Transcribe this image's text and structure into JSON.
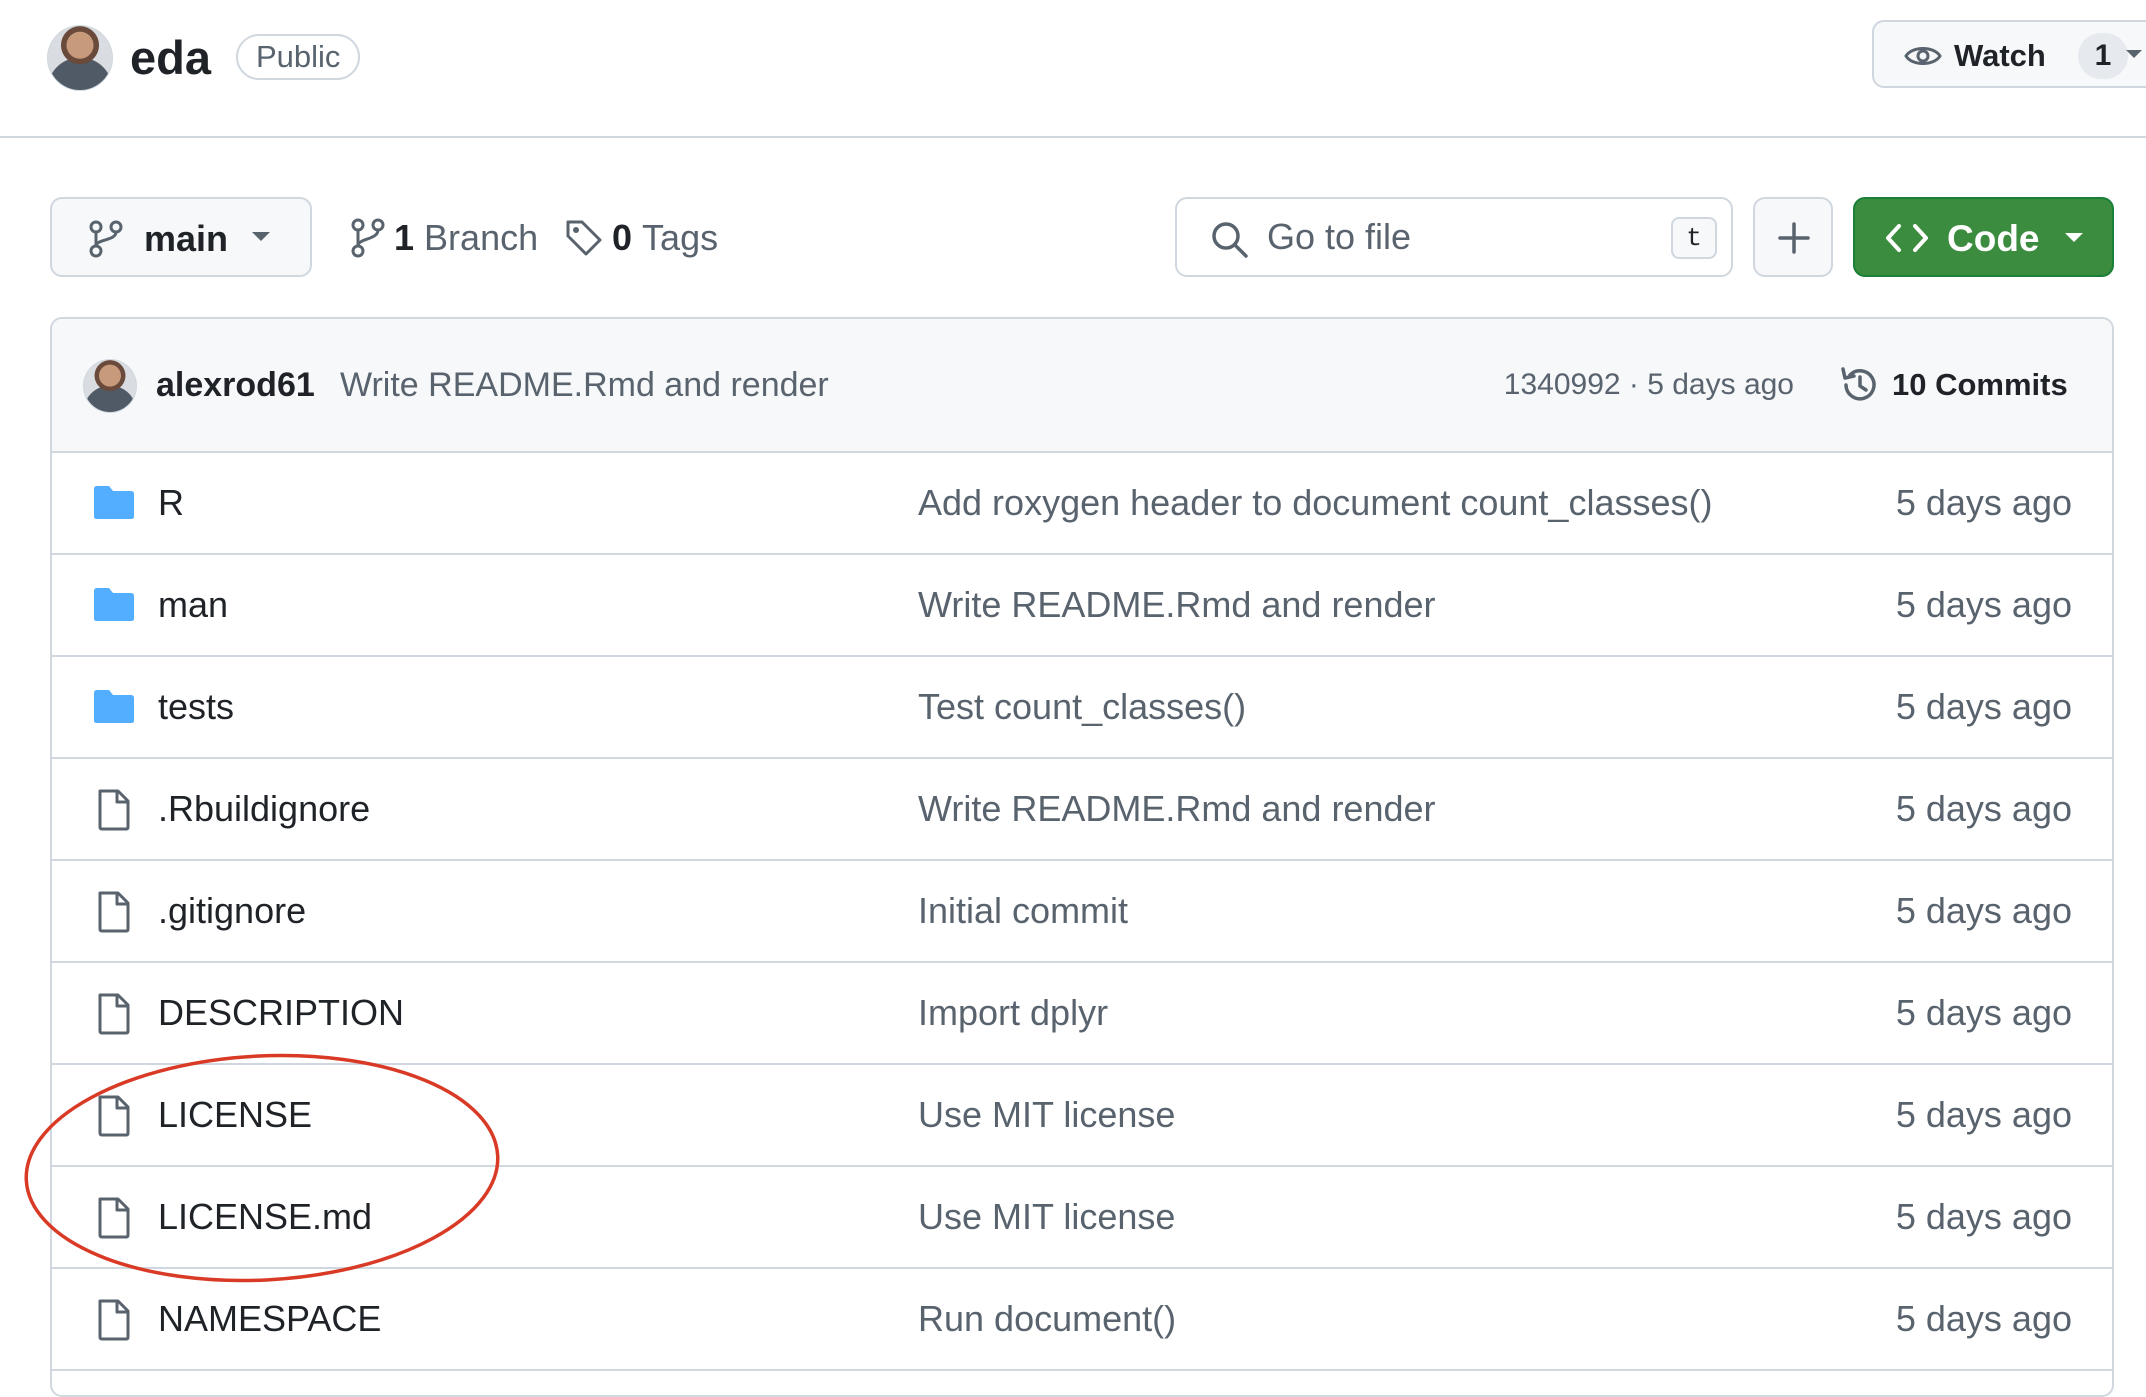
{
  "repo": {
    "name": "eda",
    "visibility": "Public",
    "watch": {
      "label": "Watch",
      "count": "1"
    }
  },
  "toolbar": {
    "branch_selector": "main",
    "branches": {
      "count": "1",
      "label": "Branch"
    },
    "tags": {
      "count": "0",
      "label": "Tags"
    },
    "search": {
      "placeholder": "Go to file",
      "shortcut": "t"
    },
    "code_label": "Code"
  },
  "latest_commit": {
    "author": "alexrod61",
    "message": "Write README.Rmd and render",
    "meta": "1340992 · 5 days ago",
    "commits_label": "10 Commits"
  },
  "files": [
    {
      "type": "folder",
      "name": "R",
      "commit": "Add roxygen header to document count_classes()",
      "date": "5 days ago"
    },
    {
      "type": "folder",
      "name": "man",
      "commit": "Write README.Rmd and render",
      "date": "5 days ago"
    },
    {
      "type": "folder",
      "name": "tests",
      "commit": "Test count_classes()",
      "date": "5 days ago"
    },
    {
      "type": "file",
      "name": ".Rbuildignore",
      "commit": "Write README.Rmd and render",
      "date": "5 days ago"
    },
    {
      "type": "file",
      "name": ".gitignore",
      "commit": "Initial commit",
      "date": "5 days ago"
    },
    {
      "type": "file",
      "name": "DESCRIPTION",
      "commit": "Import dplyr",
      "date": "5 days ago"
    },
    {
      "type": "file",
      "name": "LICENSE",
      "commit": "Use MIT license",
      "date": "5 days ago"
    },
    {
      "type": "file",
      "name": "LICENSE.md",
      "commit": "Use MIT license",
      "date": "5 days ago"
    },
    {
      "type": "file",
      "name": "NAMESPACE",
      "commit": "Run document()",
      "date": "5 days ago"
    }
  ],
  "icons": {
    "folder": "folder-icon",
    "file": "file-icon"
  },
  "colors": {
    "folder": "#54aeff",
    "code_button": "#3c8c3f",
    "annotation": "#d93a26",
    "border": "#d0d7de",
    "muted_text": "#59636e"
  }
}
